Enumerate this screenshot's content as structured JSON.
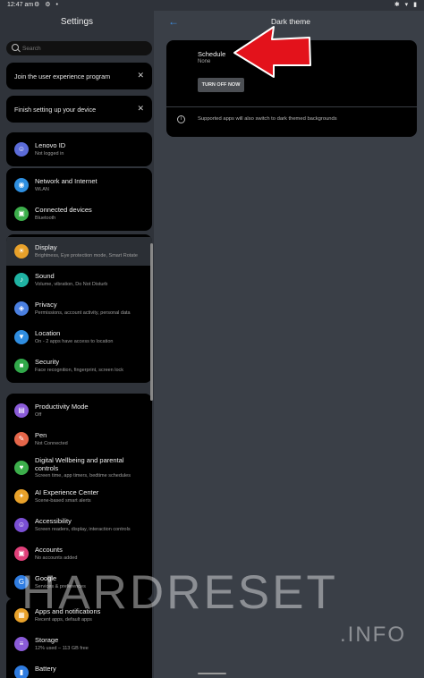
{
  "status_bar": {
    "time": "12:47 am",
    "icons_left": "⚙ ⚙ •",
    "icons_right": "✱ ▾ ▮"
  },
  "left_pane": {
    "title": "Settings",
    "search_placeholder": "Search",
    "suggestions": [
      {
        "text": "Join the user experience program"
      },
      {
        "text": "Finish setting up your device"
      }
    ],
    "close_glyph": "✕",
    "groups": [
      {
        "items": [
          {
            "icon": "person-icon",
            "glyph": "☺",
            "color": "#5b6bd8",
            "title": "Lenovo ID",
            "subtitle": "Not logged in"
          }
        ]
      },
      {
        "items": [
          {
            "icon": "wifi-icon",
            "glyph": "◉",
            "color": "#2e8fe0",
            "title": "Network and Internet",
            "subtitle": "WLAN"
          },
          {
            "icon": "devices-icon",
            "glyph": "▣",
            "color": "#3cae4b",
            "title": "Connected devices",
            "subtitle": "Bluetooth"
          }
        ]
      },
      {
        "items": [
          {
            "icon": "display-icon",
            "glyph": "☀",
            "color": "#e8a12a",
            "title": "Display",
            "subtitle": "Brightness, Eye protection mode, Smart Rotate",
            "active": true
          },
          {
            "icon": "sound-icon",
            "glyph": "♪",
            "color": "#1fb3a3",
            "title": "Sound",
            "subtitle": "Volume, vibration, Do Not Disturb"
          },
          {
            "icon": "privacy-icon",
            "glyph": "◈",
            "color": "#4a7fe0",
            "title": "Privacy",
            "subtitle": "Permissions, account activity, personal data"
          },
          {
            "icon": "location-icon",
            "glyph": "▼",
            "color": "#2f8de0",
            "title": "Location",
            "subtitle": "On - 2 apps have access to location"
          },
          {
            "icon": "security-icon",
            "glyph": "■",
            "color": "#31a84a",
            "title": "Security",
            "subtitle": "Face recognition, fingerprint, screen lock"
          }
        ]
      },
      {
        "items": [
          {
            "icon": "productivity-icon",
            "glyph": "▤",
            "color": "#8a5bd8",
            "title": "Productivity Mode",
            "subtitle": "Off"
          },
          {
            "icon": "pen-icon",
            "glyph": "✎",
            "color": "#e5664a",
            "title": "Pen",
            "subtitle": "Not Connected"
          },
          {
            "icon": "wellbeing-icon",
            "glyph": "♥",
            "color": "#3cae4b",
            "title": "Digital Wellbeing and parental controls",
            "subtitle": "Screen time, app timers, bedtime schedules"
          },
          {
            "icon": "ai-icon",
            "glyph": "✦",
            "color": "#e8a12a",
            "title": "AI Experience Center",
            "subtitle": "Scene-based smart alerts"
          },
          {
            "icon": "accessibility-icon",
            "glyph": "☺",
            "color": "#7a4fd3",
            "title": "Accessibility",
            "subtitle": "Screen readers, display, interaction controls"
          },
          {
            "icon": "accounts-icon",
            "glyph": "▣",
            "color": "#e0407a",
            "title": "Accounts",
            "subtitle": "No accounts added"
          },
          {
            "icon": "google-icon",
            "glyph": "G",
            "color": "#2f7ce0",
            "title": "Google",
            "subtitle": "Services & preferences"
          }
        ]
      },
      {
        "items": [
          {
            "icon": "apps-icon",
            "glyph": "▦",
            "color": "#e8a12a",
            "title": "Apps and notifications",
            "subtitle": "Recent apps, default apps"
          },
          {
            "icon": "storage-icon",
            "glyph": "≡",
            "color": "#8a5bd8",
            "title": "Storage",
            "subtitle": "12% used – 113 GB free"
          },
          {
            "icon": "battery-icon",
            "glyph": "▮",
            "color": "#2f7ce0",
            "title": "Battery",
            "subtitle": ""
          }
        ]
      }
    ]
  },
  "right_pane": {
    "back_glyph": "←",
    "title": "Dark theme",
    "schedule": {
      "label": "Schedule",
      "value": "None"
    },
    "turn_off_label": "TURN OFF NOW",
    "info_glyph": "i",
    "info_text": "Supported apps will also switch to dark themed backgrounds"
  },
  "watermark": {
    "main": "HARDRESET",
    "sub": ".INFO"
  },
  "colors": {
    "accent": "#3d8fe3",
    "arrow": "#e3121b"
  }
}
